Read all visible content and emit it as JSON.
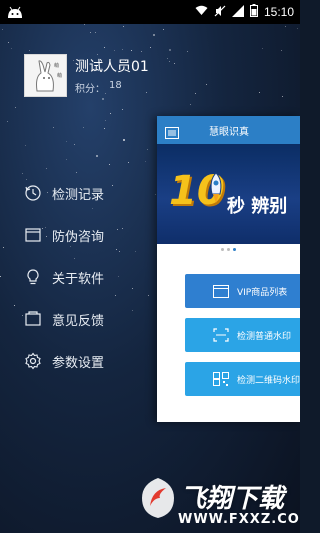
{
  "status_bar": {
    "time": "15:10",
    "icons": [
      "android-icon",
      "wifi-icon",
      "mute-icon",
      "signal-icon",
      "battery-icon"
    ]
  },
  "profile": {
    "name": "测试人员01",
    "score_label": "积分：",
    "score_value": "18",
    "avatar_icon": "rabbit-avatar-icon"
  },
  "menu": {
    "items": [
      {
        "label": "检测记录",
        "icon": "history-icon"
      },
      {
        "label": "防伪咨询",
        "icon": "window-icon"
      },
      {
        "label": "关于软件",
        "icon": "lightbulb-icon"
      },
      {
        "label": "意见反馈",
        "icon": "feedback-icon"
      },
      {
        "label": "参数设置",
        "icon": "gear-icon"
      }
    ]
  },
  "main": {
    "title": "慧眼识真",
    "banner": {
      "number": "10",
      "slogan": "秒 辨别"
    },
    "carousel": {
      "count": 3,
      "active_index": 2
    },
    "buttons": [
      {
        "label": "VIP商品列表",
        "icon": "list-icon"
      },
      {
        "label": "检测普通水印",
        "icon": "scan-icon"
      },
      {
        "label": "检测二维码水印",
        "icon": "qrcode-icon"
      }
    ]
  },
  "watermark": {
    "text": "飞翔下载",
    "url": "WWW.FXXZ.COM"
  },
  "colors": {
    "accent": "#2c7fc6",
    "button": "#2ba4e6",
    "drawer_bg": "#14253f"
  }
}
